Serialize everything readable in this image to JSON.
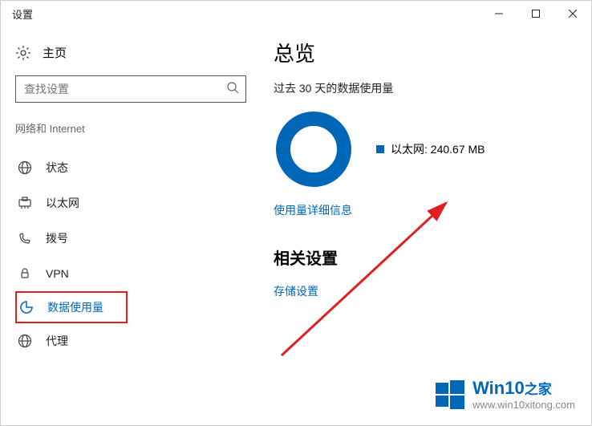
{
  "window": {
    "title": "设置"
  },
  "sidebar": {
    "home_label": "主页",
    "search_placeholder": "查找设置",
    "category_label": "网络和 Internet",
    "items": [
      {
        "label": "状态"
      },
      {
        "label": "以太网"
      },
      {
        "label": "拨号"
      },
      {
        "label": "VPN"
      },
      {
        "label": "数据使用量"
      },
      {
        "label": "代理"
      }
    ]
  },
  "main": {
    "heading": "总览",
    "period_text": "过去 30 天的数据使用量",
    "legend_label": "以太网: 240.67 MB",
    "details_link": "使用量详细信息",
    "related_heading": "相关设置",
    "storage_link": "存储设置"
  },
  "chart_data": {
    "type": "pie",
    "title": "过去 30 天的数据使用量",
    "series": [
      {
        "name": "以太网",
        "value": 240.67,
        "unit": "MB",
        "color": "#0067b8"
      }
    ]
  },
  "watermark": {
    "brand": "Win10",
    "suffix": "之家",
    "url": "www.win10xitong.com"
  }
}
